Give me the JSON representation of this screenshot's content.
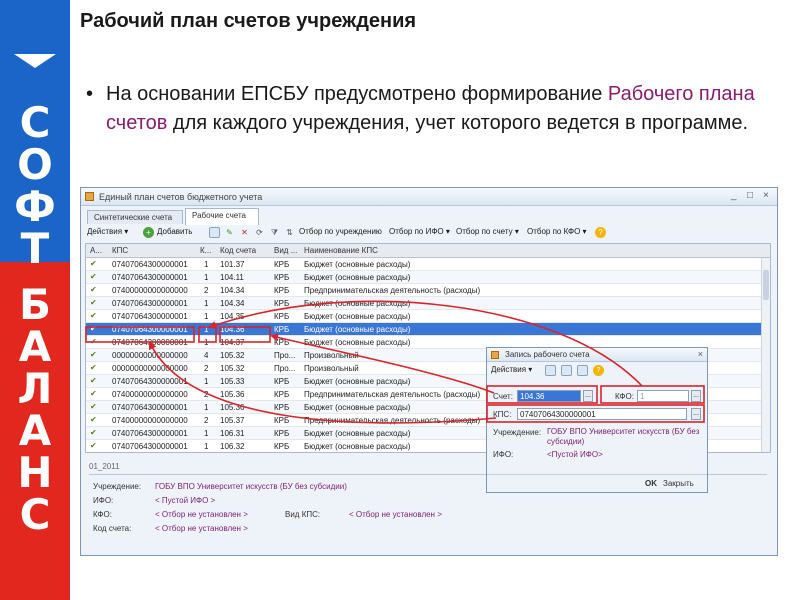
{
  "brand": {
    "letters": [
      "С",
      "О",
      "Ф",
      "Т",
      "Б",
      "А",
      "Л",
      "А",
      "Н",
      "С"
    ],
    "colors": {
      "blue": "#1b64c8",
      "red": "#e2281e"
    }
  },
  "slide": {
    "title": "Рабочий план счетов учреждения",
    "bullet": {
      "marker": "•",
      "before": "На основании ЕПСБУ предусмотрено формирование ",
      "accent": "Рабочего плана счетов",
      "after": " для каждого учреждения, учет которого ведется в программе.",
      "accent_color": "#8b1b6f"
    }
  },
  "window": {
    "title": "Единый план счетов бюджетного учета",
    "controls": {
      "minimize": "_",
      "maximize": "□",
      "close": "×"
    },
    "tabs": [
      {
        "label": "Синтетические счета"
      },
      {
        "label": "Рабочие счета"
      }
    ],
    "toolbar": {
      "actions": "Действия ▾",
      "add": "Добавить",
      "filter_institution": "Отбор по учреждению",
      "filter_ifo": "Отбор по ИФО ▾",
      "filter_account": "Отбор по счету ▾",
      "filter_kfo": "Отбор по КФО ▾",
      "help": "?"
    },
    "grid": {
      "headers": [
        "А...",
        "КПС",
        "К...",
        "Код счета",
        "Вид ...",
        "Наименование КПС"
      ],
      "rows": [
        {
          "kps": "07407064300000001",
          "k": "1",
          "code": "101.37",
          "vid": "КРБ",
          "name": "Бюджет (основные расходы)"
        },
        {
          "kps": "07407064300000001",
          "k": "1",
          "code": "104.11",
          "vid": "КРБ",
          "name": "Бюджет (основные расходы)"
        },
        {
          "kps": "07400000000000000",
          "k": "2",
          "code": "104.34",
          "vid": "КРБ",
          "name": "Предпринимательская деятельность (расходы)"
        },
        {
          "kps": "07407064300000001",
          "k": "1",
          "code": "104.34",
          "vid": "КРБ",
          "name": "Бюджет (основные расходы)"
        },
        {
          "kps": "07407064300000001",
          "k": "1",
          "code": "104.35",
          "vid": "КРБ",
          "name": "Бюджет (основные расходы)"
        },
        {
          "kps": "07407064300000001",
          "k": "1",
          "code": "104.36",
          "vid": "КРБ",
          "name": "Бюджет (основные расходы)"
        },
        {
          "kps": "07407064300000001",
          "k": "1",
          "code": "104.37",
          "vid": "КРБ",
          "name": "Бюджет (основные расходы)"
        },
        {
          "kps": "00000000000000000",
          "k": "4",
          "code": "105.32",
          "vid": "Про...",
          "name": "Произвольный"
        },
        {
          "kps": "00000000000000000",
          "k": "2",
          "code": "105.32",
          "vid": "Про...",
          "name": "Произвольный"
        },
        {
          "kps": "07407064300000001",
          "k": "1",
          "code": "105.33",
          "vid": "КРБ",
          "name": "Бюджет (основные расходы)"
        },
        {
          "kps": "07400000000000000",
          "k": "2",
          "code": "105.36",
          "vid": "КРБ",
          "name": "Предпринимательская деятельность (расходы)"
        },
        {
          "kps": "07407064300000001",
          "k": "1",
          "code": "105.36",
          "vid": "КРБ",
          "name": "Бюджет (основные расходы)"
        },
        {
          "kps": "07400000000000000",
          "k": "2",
          "code": "105.37",
          "vid": "КРБ",
          "name": "Предпринимательская деятельность (расходы)"
        },
        {
          "kps": "07407064300000001",
          "k": "1",
          "code": "106.31",
          "vid": "КРБ",
          "name": "Бюджет (основные расходы)"
        },
        {
          "kps": "07407064300000001",
          "k": "1",
          "code": "106.32",
          "vid": "КРБ",
          "name": "Бюджет (основные расходы)"
        }
      ],
      "selected_index": 5
    },
    "footer": {
      "code": "01_2011",
      "institution_label": "Учреждение:",
      "institution_value": "ГОБУ ВПО Университет искусств (БУ без субсидии)",
      "ifo_label": "ИФО:",
      "ifo_value": "< Пустой ИФО >",
      "kfo_label": "КФО:",
      "kfo_value": "< Отбор не установлен >",
      "vid_kps_label": "Вид КПС:",
      "vid_kps_value": "< Отбор не установлен >",
      "account_label": "Код счета:",
      "account_value": "< Отбор не установлен >"
    }
  },
  "dialog": {
    "title": "Запись рабочего счета",
    "close": "×",
    "actions": "Действия ▾",
    "account_label": "Счет:",
    "account_value": "104.36",
    "kfo_label": "КФО:",
    "kfo_value": "1",
    "kps_label": "КПС:",
    "kps_value": "07407064300000001",
    "institution_label": "Учреждение:",
    "institution_value": "ГОБУ ВПО Университет искусств (БУ без субсидии)",
    "ifo_label": "ИФО:",
    "ifo_value": "<Пустой ИФО>",
    "ok": "OK",
    "close_button": "Закрыть",
    "ellipsis": "..."
  },
  "highlight_color": "#d8242a"
}
